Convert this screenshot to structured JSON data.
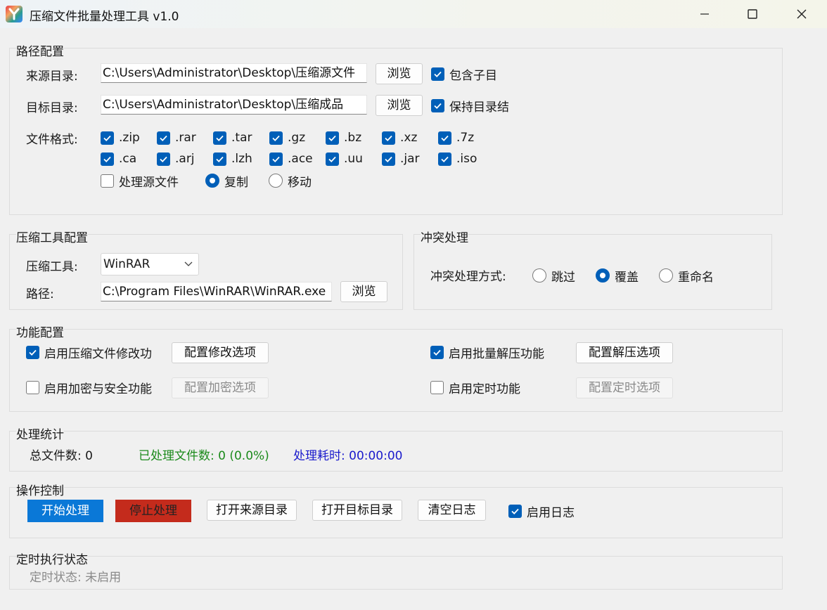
{
  "window": {
    "title": "压缩文件批量处理工具 v1.0"
  },
  "path_config": {
    "title": "路径配置",
    "source_label": "来源目录:",
    "source_value": "C:\\Users\\Administrator\\Desktop\\压缩源文件",
    "source_browse": "浏览",
    "include_sub": {
      "label": "包含子目",
      "checked": true
    },
    "target_label": "目标目录:",
    "target_value": "C:\\Users\\Administrator\\Desktop\\压缩成品",
    "target_browse": "浏览",
    "keep_structure": {
      "label": "保持目录结",
      "checked": true
    },
    "format_label": "文件格式:",
    "formats": [
      {
        "label": ".zip",
        "checked": true
      },
      {
        "label": ".rar",
        "checked": true
      },
      {
        "label": ".tar",
        "checked": true
      },
      {
        "label": ".gz",
        "checked": true
      },
      {
        "label": ".bz",
        "checked": true
      },
      {
        "label": ".xz",
        "checked": true
      },
      {
        "label": ".7z",
        "checked": true
      },
      {
        "label": ".ca",
        "checked": true
      },
      {
        "label": ".arj",
        "checked": true
      },
      {
        "label": ".lzh",
        "checked": true
      },
      {
        "label": ".ace",
        "checked": true
      },
      {
        "label": ".uu",
        "checked": true
      },
      {
        "label": ".jar",
        "checked": true
      },
      {
        "label": ".iso",
        "checked": true
      }
    ],
    "process_source": {
      "label": "处理源文件",
      "checked": false
    },
    "mode_copy": {
      "label": "复制",
      "selected": true
    },
    "mode_move": {
      "label": "移动",
      "selected": false
    }
  },
  "tool_config": {
    "title": "压缩工具配置",
    "tool_label": "压缩工具:",
    "tool_value": "WinRAR",
    "path_label": "路径:",
    "path_value": "C:\\Program Files\\WinRAR\\WinRAR.exe",
    "browse": "浏览"
  },
  "conflict": {
    "title": "冲突处理",
    "label": "冲突处理方式:",
    "options": [
      {
        "label": "跳过",
        "selected": false
      },
      {
        "label": "覆盖",
        "selected": true
      },
      {
        "label": "重命名",
        "selected": false
      }
    ]
  },
  "features": {
    "title": "功能配置",
    "modify": {
      "label": "启用压缩文件修改功",
      "checked": true,
      "button": "配置修改选项"
    },
    "extract": {
      "label": "启用批量解压功能",
      "checked": true,
      "button": "配置解压选项"
    },
    "encrypt": {
      "label": "启用加密与安全功能",
      "checked": false,
      "button": "配置加密选项"
    },
    "schedule": {
      "label": "启用定时功能",
      "checked": false,
      "button": "配置定时选项"
    }
  },
  "stats": {
    "title": "处理统计",
    "total": "总文件数: 0",
    "processed": "已处理文件数: 0 (0.0%)",
    "elapsed": "处理耗时: 00:00:00",
    "colors": {
      "processed": "#1b8a1b",
      "elapsed": "#1a1acc"
    }
  },
  "controls": {
    "title": "操作控制",
    "start": "开始处理",
    "stop": "停止处理",
    "open_source": "打开来源目录",
    "open_target": "打开目标目录",
    "clear_log": "清空日志",
    "enable_log": {
      "label": "启用日志",
      "checked": true
    }
  },
  "schedule_status": {
    "title": "定时执行状态",
    "status": "定时状态: 未启用"
  },
  "colors": {
    "accent": "#005fb8",
    "start_bg": "#0a78d7",
    "stop_bg": "#c42b1c"
  }
}
